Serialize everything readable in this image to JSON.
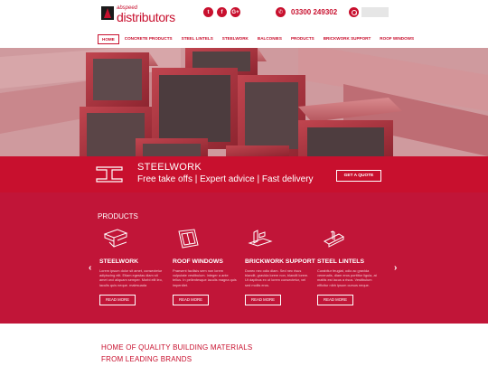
{
  "header": {
    "logo_top": "abspeed",
    "logo_bottom": "distributors",
    "social": [
      {
        "label": "t",
        "icon": "twitter-icon"
      },
      {
        "label": "f",
        "icon": "facebook-icon"
      },
      {
        "label": "G+",
        "icon": "google-plus-icon"
      }
    ],
    "phone_icon": "✆",
    "phone": "03300 249302",
    "search_placeholder": ""
  },
  "nav": [
    {
      "label": "HOME",
      "active": true
    },
    {
      "label": "CONCRETE PRODUCTS"
    },
    {
      "label": "STEEL LINTELS"
    },
    {
      "label": "STEELWORK"
    },
    {
      "label": "BALCONIES"
    },
    {
      "label": "PRODUCTS"
    },
    {
      "label": "BRICKWORK SUPPORT"
    },
    {
      "label": "ROOF WINDOWS"
    }
  ],
  "banner": {
    "title": "STEELWORK",
    "subtitle": "Free take offs | Expert advice | Fast delivery",
    "cta": "GET A QUOTE"
  },
  "products": {
    "heading": "PRODUCTS",
    "prev": "‹",
    "next": "›",
    "items": [
      {
        "title": "STEELWORK",
        "text": "Lorem ipsum dolor sit amet, consectetur adipiscing elit. Etiam egestas diam sit amet orci aliquam semper. Morbi elit leo, iaculis quis neque. malesuada",
        "button": "READ MORE"
      },
      {
        "title": "ROOF WINDOWS",
        "text": "Praesent facilisis sem non lorem vulputate vestibulum. Integer a ante tellus. In pellentesque iaculis magna quis imperdiet.",
        "button": "READ MORE"
      },
      {
        "title": "BRICKWORK SUPPORT",
        "text": "Donec nec odio diam. Sed nec risus blandit, gravida lorem non, blandit lorem. Ut dapibus ex ut lorem consectetur, vel sed mollis eros.",
        "button": "READ MORE"
      },
      {
        "title": "STEEL LINTELS",
        "text": "Curabitur feugiat, odio ac gravida venenatis, diam eros porttitor ligula, at mattis est lacus a risus. Vestibulum efficitur nibh ipsum cursus neque.",
        "button": "READ MORE"
      }
    ]
  },
  "home": {
    "line1": "HOME OF QUALITY BUILDING MATERIALS",
    "line2": "FROM LEADING BRANDS"
  },
  "colors": {
    "brand": "#c8102e",
    "products_bg": "#c11538"
  }
}
